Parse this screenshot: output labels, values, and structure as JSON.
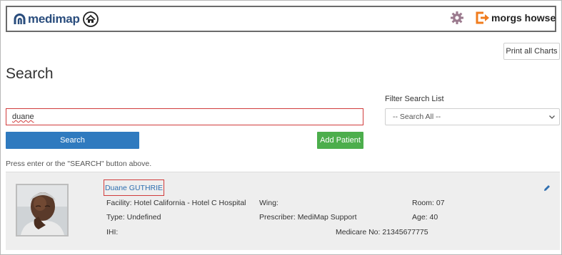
{
  "header": {
    "logo_text": "medimap",
    "home_icon": "home-icon",
    "settings_icon": "gear-icon",
    "logout_icon": "exit-icon",
    "user_name": "morgs howse",
    "colors": {
      "brand": "#2a4d7d",
      "gear": "#9b7a8e",
      "exit": "#f07c1e"
    }
  },
  "actions": {
    "print_label": "Print all Charts"
  },
  "page": {
    "title": "Search"
  },
  "filter": {
    "label": "Filter Search List",
    "selected": "-- Search All --"
  },
  "search": {
    "value": "duane",
    "button_label": "Search",
    "add_label": "Add Patient",
    "hint": "Press enter or the \"SEARCH\" button above."
  },
  "result": {
    "name": "Duane GUTHRIE",
    "facility_label": "Facility:",
    "facility": "Hotel California - Hotel C Hospital",
    "wing_label": "Wing:",
    "wing": "",
    "room_label": "Room:",
    "room": "07",
    "type_label": "Type:",
    "type": "Undefined",
    "prescriber_label": "Prescriber:",
    "prescriber": "MediMap Support",
    "age_label": "Age:",
    "age": "40",
    "ihi_label": "IHI:",
    "ihi": "",
    "medicare_label": "Medicare No:",
    "medicare": "21345677775"
  },
  "colors": {
    "primary": "#2f7abf",
    "success": "#4cae4c",
    "highlight": "#d13c3c",
    "link": "#2f6fb0"
  }
}
